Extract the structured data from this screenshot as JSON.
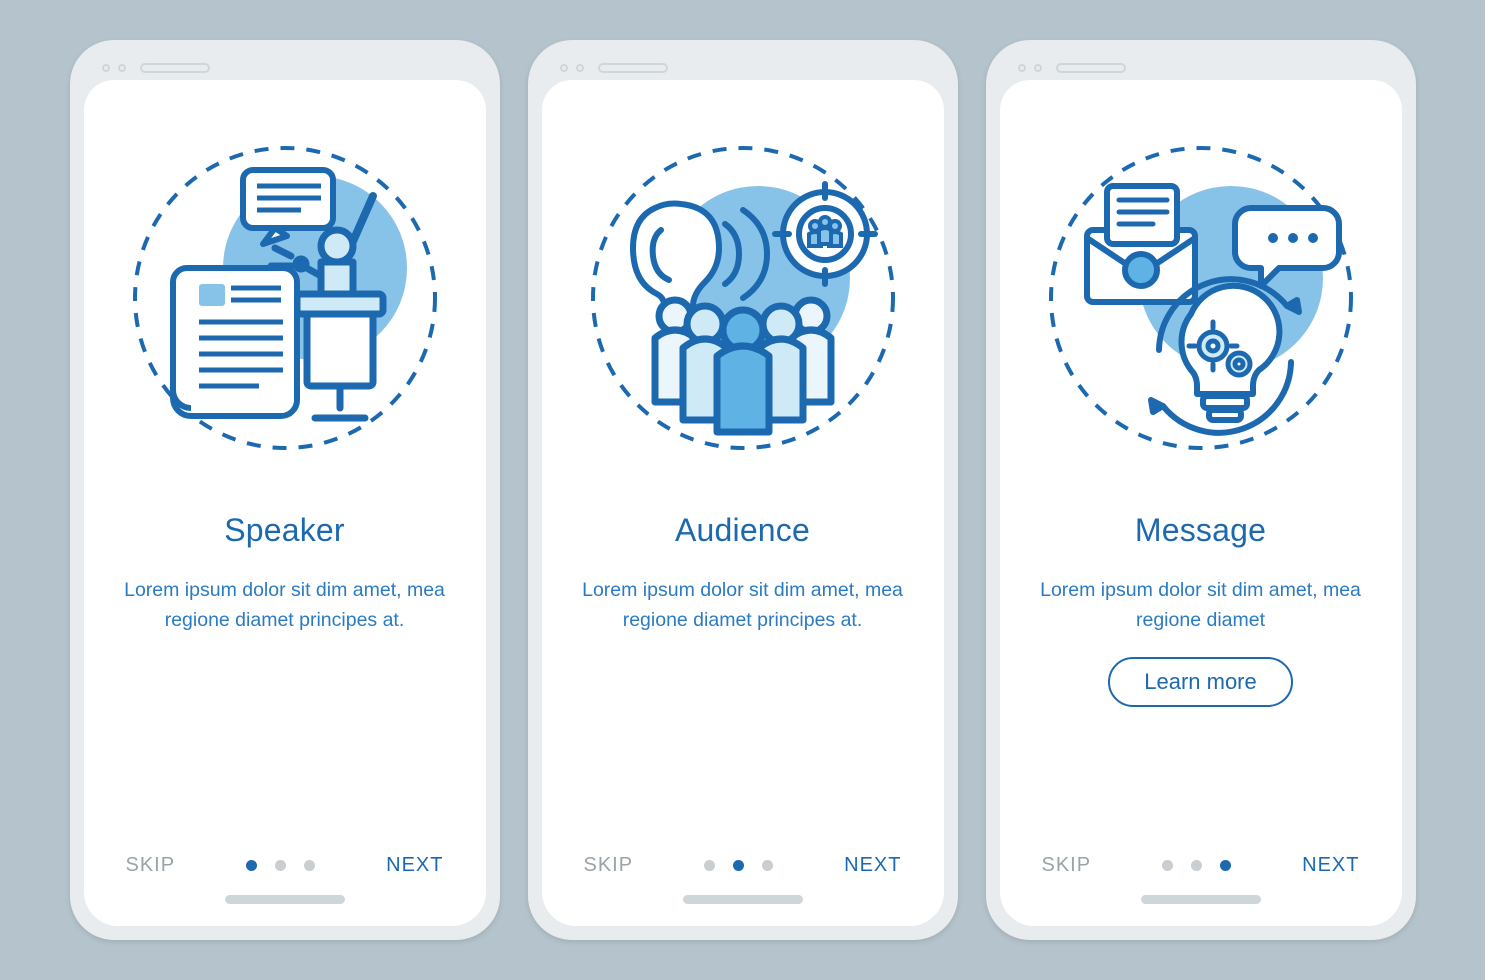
{
  "colors": {
    "background": "#b5c4cc",
    "primary": "#1c69b0",
    "secondaryText": "#2a7bc4",
    "inactive": "#c8ced2",
    "muted": "#9aa3a8"
  },
  "screens": [
    {
      "icon_name": "speaker-podium-icon",
      "title": "Speaker",
      "description": "Lorem ipsum dolor sit dim amet, mea regione diamet principes at.",
      "skip_label": "SKIP",
      "next_label": "NEXT",
      "active_dot": 0,
      "learn_more": null
    },
    {
      "icon_name": "audience-group-icon",
      "title": "Audience",
      "description": "Lorem ipsum dolor sit dim amet, mea regione diamet principes at.",
      "skip_label": "SKIP",
      "next_label": "NEXT",
      "active_dot": 1,
      "learn_more": null
    },
    {
      "icon_name": "message-idea-icon",
      "title": "Message",
      "description": "Lorem ipsum dolor sit dim amet, mea regione diamet",
      "skip_label": "SKIP",
      "next_label": "NEXT",
      "active_dot": 2,
      "learn_more": "Learn more"
    }
  ]
}
